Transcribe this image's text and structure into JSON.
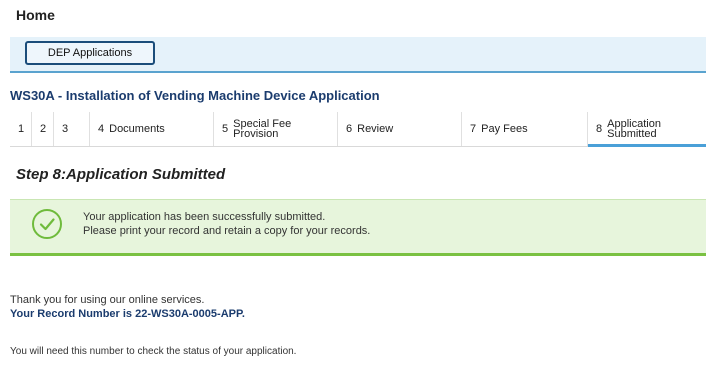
{
  "header": {
    "home_label": "Home"
  },
  "dep": {
    "button_label": "DEP Applications"
  },
  "application": {
    "title": "WS30A - Installation of Vending Machine Device Application"
  },
  "steps": [
    {
      "num": "1",
      "label": ""
    },
    {
      "num": "2",
      "label": ""
    },
    {
      "num": "3",
      "label": ""
    },
    {
      "num": "4",
      "label": "Documents"
    },
    {
      "num": "5",
      "label": "Special Fee Provision"
    },
    {
      "num": "6",
      "label": "Review"
    },
    {
      "num": "7",
      "label": "Pay Fees"
    },
    {
      "num": "8",
      "label": "Application Submitted",
      "active": true
    }
  ],
  "step_heading": "Step 8:Application Submitted",
  "success": {
    "line1": "Your application has been successfully submitted.",
    "line2": "Please print your record and retain a copy for your records.",
    "icon": "check-circle-icon"
  },
  "thanks": "Thank you for using our online services.",
  "record_line": "Your Record Number is 22-WS30A-0005-APP.",
  "note": "You will need this number to check the status of your application.",
  "colors": {
    "accent": "#4aa0d8",
    "success": "#7ac142",
    "title": "#1b3c6e"
  }
}
